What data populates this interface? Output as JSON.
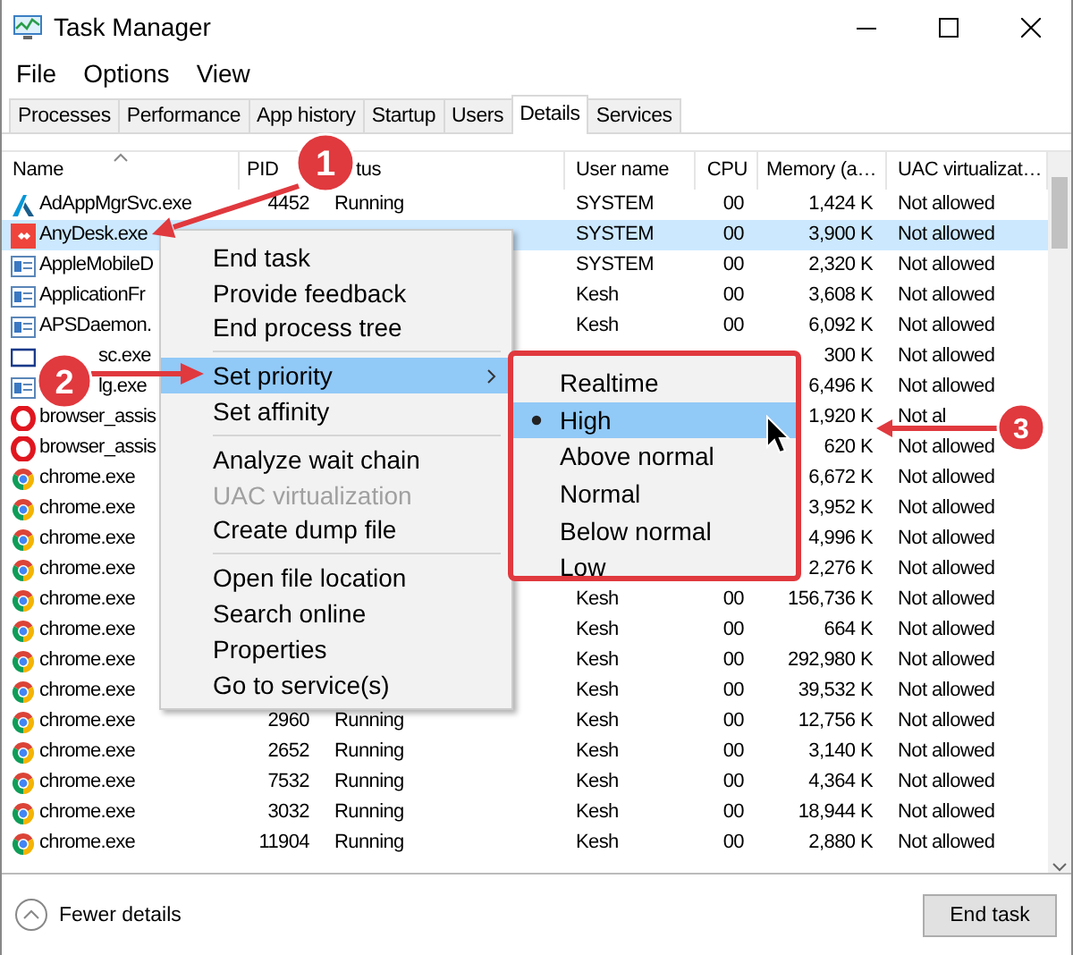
{
  "window": {
    "title": "Task Manager"
  },
  "menu_bar": [
    "File",
    "Options",
    "View"
  ],
  "tabs": [
    {
      "label": "Processes",
      "selected": false
    },
    {
      "label": "Performance",
      "selected": false
    },
    {
      "label": "App history",
      "selected": false
    },
    {
      "label": "Startup",
      "selected": false
    },
    {
      "label": "Users",
      "selected": false
    },
    {
      "label": "Details",
      "selected": true
    },
    {
      "label": "Services",
      "selected": false
    }
  ],
  "table": {
    "columns": [
      "Name",
      "PID",
      "tus",
      "User name",
      "CPU",
      "Memory (a…",
      "UAC virtualizat…"
    ],
    "rows": [
      {
        "kind": "autodesk",
        "name": "AdAppMgrSvc.exe",
        "pid": "4452",
        "status": "Running",
        "user": "SYSTEM",
        "cpu": "00",
        "memory": "1,424 K",
        "uac": "Not allowed",
        "selected": false
      },
      {
        "kind": "anydesk",
        "name": "AnyDesk.exe",
        "user": "SYSTEM",
        "cpu": "00",
        "memory": "3,900 K",
        "uac": "Not allowed",
        "selected": true
      },
      {
        "kind": "window",
        "name": "AppleMobileD",
        "user": "SYSTEM",
        "cpu": "00",
        "memory": "2,320 K",
        "uac": "Not allowed",
        "selected": false
      },
      {
        "kind": "window",
        "name": "ApplicationFr",
        "user": "Kesh",
        "cpu": "00",
        "memory": "3,608 K",
        "uac": "Not allowed",
        "selected": false
      },
      {
        "kind": "window",
        "name": "APSDaemon.",
        "user": "Kesh",
        "cpu": "00",
        "memory": "6,092 K",
        "uac": "Not allowed",
        "selected": false
      },
      {
        "kind": "frame",
        "name": "sc.exe",
        "memory": "300 K",
        "uac": "Not allowed",
        "selected": false
      },
      {
        "kind": "window",
        "name": "lg.exe",
        "memory": "6,496 K",
        "uac": "Not allowed",
        "selected": false
      },
      {
        "kind": "opera",
        "name": "browser_assis",
        "memory": "1,920 K",
        "uac": "Not al",
        "selected": false
      },
      {
        "kind": "opera",
        "name": "browser_assis",
        "memory": "620 K",
        "uac": "Not allowed",
        "selected": false
      },
      {
        "kind": "chrome",
        "name": "chrome.exe",
        "memory": "6,672 K",
        "uac": "Not allowed",
        "selected": false
      },
      {
        "kind": "chrome",
        "name": "chrome.exe",
        "memory": "3,952 K",
        "uac": "Not allowed",
        "selected": false
      },
      {
        "kind": "chrome",
        "name": "chrome.exe",
        "memory": "4,996 K",
        "uac": "Not allowed",
        "selected": false
      },
      {
        "kind": "chrome",
        "name": "chrome.exe",
        "memory": "2,276 K",
        "uac": "Not allowed",
        "selected": false
      },
      {
        "kind": "chrome",
        "name": "chrome.exe",
        "user": "Kesh",
        "cpu": "00",
        "memory": "156,736 K",
        "uac": "Not allowed",
        "selected": false
      },
      {
        "kind": "chrome",
        "name": "chrome.exe",
        "user": "Kesh",
        "cpu": "00",
        "memory": "664 K",
        "uac": "Not allowed",
        "selected": false
      },
      {
        "kind": "chrome",
        "name": "chrome.exe",
        "user": "Kesh",
        "cpu": "00",
        "memory": "292,980 K",
        "uac": "Not allowed",
        "selected": false
      },
      {
        "kind": "chrome",
        "name": "chrome.exe",
        "user": "Kesh",
        "cpu": "00",
        "memory": "39,532 K",
        "uac": "Not allowed",
        "selected": false
      },
      {
        "kind": "chrome",
        "name": "chrome.exe",
        "pid": "2960",
        "status": "Running",
        "user": "Kesh",
        "cpu": "00",
        "memory": "12,756 K",
        "uac": "Not allowed",
        "selected": false
      },
      {
        "kind": "chrome",
        "name": "chrome.exe",
        "pid": "2652",
        "status": "Running",
        "user": "Kesh",
        "cpu": "00",
        "memory": "3,140 K",
        "uac": "Not allowed",
        "selected": false
      },
      {
        "kind": "chrome",
        "name": "chrome.exe",
        "pid": "7532",
        "status": "Running",
        "user": "Kesh",
        "cpu": "00",
        "memory": "4,364 K",
        "uac": "Not allowed",
        "selected": false
      },
      {
        "kind": "chrome",
        "name": "chrome.exe",
        "pid": "3032",
        "status": "Running",
        "user": "Kesh",
        "cpu": "00",
        "memory": "18,944 K",
        "uac": "Not allowed",
        "selected": false
      },
      {
        "kind": "chrome",
        "name": "chrome.exe",
        "pid": "11904",
        "status": "Running",
        "user": "Kesh",
        "cpu": "00",
        "memory": "2,880 K",
        "uac": "Not allowed",
        "selected": false
      }
    ]
  },
  "context_menu": {
    "groups": [
      [
        {
          "label": "End task",
          "highlighted": false,
          "disabled": false,
          "submenu": false
        },
        {
          "label": "Provide feedback",
          "highlighted": false,
          "disabled": false,
          "submenu": false
        },
        {
          "label": "End process tree",
          "highlighted": false,
          "disabled": false,
          "submenu": false
        }
      ],
      [
        {
          "label": "Set priority",
          "highlighted": true,
          "disabled": false,
          "submenu": true
        },
        {
          "label": "Set affinity",
          "highlighted": false,
          "disabled": false,
          "submenu": false
        }
      ],
      [
        {
          "label": "Analyze wait chain",
          "highlighted": false,
          "disabled": false,
          "submenu": false
        },
        {
          "label": "UAC virtualization",
          "highlighted": false,
          "disabled": true,
          "submenu": false
        },
        {
          "label": "Create dump file",
          "highlighted": false,
          "disabled": false,
          "submenu": false
        }
      ],
      [
        {
          "label": "Open file location",
          "highlighted": false,
          "disabled": false,
          "submenu": false
        },
        {
          "label": "Search online",
          "highlighted": false,
          "disabled": false,
          "submenu": false
        },
        {
          "label": "Properties",
          "highlighted": false,
          "disabled": false,
          "submenu": false
        },
        {
          "label": "Go to service(s)",
          "highlighted": false,
          "disabled": false,
          "submenu": false
        }
      ]
    ]
  },
  "priority_menu": {
    "items": [
      {
        "label": "Realtime",
        "selected": false,
        "highlighted": false
      },
      {
        "label": "High",
        "selected": true,
        "highlighted": true
      },
      {
        "label": "Above normal",
        "selected": false,
        "highlighted": false
      },
      {
        "label": "Normal",
        "selected": false,
        "highlighted": false
      },
      {
        "label": "Below normal",
        "selected": false,
        "highlighted": false
      },
      {
        "label": "Low",
        "selected": false,
        "highlighted": false
      }
    ]
  },
  "callouts": [
    {
      "number": "1"
    },
    {
      "number": "2"
    },
    {
      "number": "3"
    }
  ],
  "footer": {
    "toggle": "Fewer details",
    "button": "End task"
  }
}
